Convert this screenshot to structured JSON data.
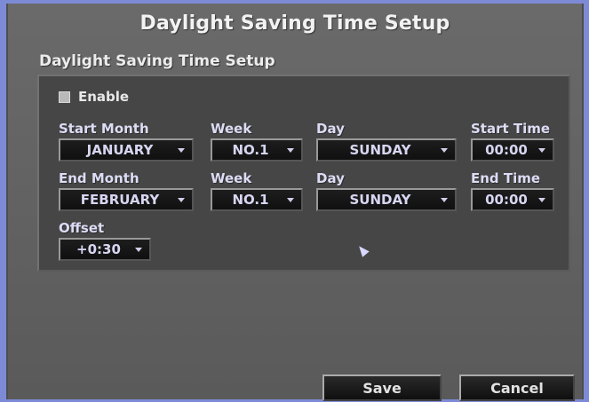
{
  "dialog": {
    "title": "Daylight Saving Time Setup",
    "section_title": "Daylight Saving Time Setup"
  },
  "enable": {
    "label": "Enable",
    "checked": false
  },
  "start": {
    "month_label": "Start Month",
    "month_value": "JANUARY",
    "week_label": "Week",
    "week_value": "NO.1",
    "day_label": "Day",
    "day_value": "SUNDAY",
    "time_label": "Start Time",
    "time_value": "00:00"
  },
  "end": {
    "month_label": "End Month",
    "month_value": "FEBRUARY",
    "week_label": "Week",
    "week_value": "NO.1",
    "day_label": "Day",
    "day_value": "SUNDAY",
    "time_label": "End Time",
    "time_value": "00:00"
  },
  "offset": {
    "label": "Offset",
    "value": "+0:30"
  },
  "buttons": {
    "save": "Save",
    "cancel": "Cancel"
  },
  "icons": {
    "dropdown": "chevron-down-icon",
    "checkbox": "checkbox-icon",
    "pointer": "mouse-pointer-icon"
  },
  "colors": {
    "desktop_bg": "#7d8bd6",
    "dialog_bg": "#626262",
    "panel_bg": "#464646",
    "field_bg": "#141414",
    "label_text": "#dcdcf5"
  }
}
